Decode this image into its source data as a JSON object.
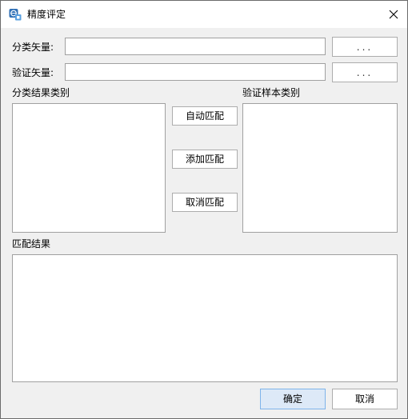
{
  "window": {
    "title": "精度评定",
    "close_symbol": "✕"
  },
  "classified_vector": {
    "label": "分类矢量:",
    "value": "",
    "browse_label": "..."
  },
  "validation_vector": {
    "label": "验证矢量:",
    "value": "",
    "browse_label": "..."
  },
  "classified_classes": {
    "label": "分类结果类别",
    "items": []
  },
  "validation_classes": {
    "label": "验证样本类别",
    "items": []
  },
  "match_buttons": {
    "auto": "自动匹配",
    "add": "添加匹配",
    "cancel": "取消匹配"
  },
  "match_result": {
    "label": "匹配结果",
    "items": []
  },
  "footer": {
    "ok": "确定",
    "cancel": "取消"
  },
  "colors": {
    "accent_button_bg": "#dde9f7",
    "accent_button_border": "#7eb4ea"
  },
  "icons": {
    "app": "globe-app-icon",
    "close": "close-icon"
  }
}
